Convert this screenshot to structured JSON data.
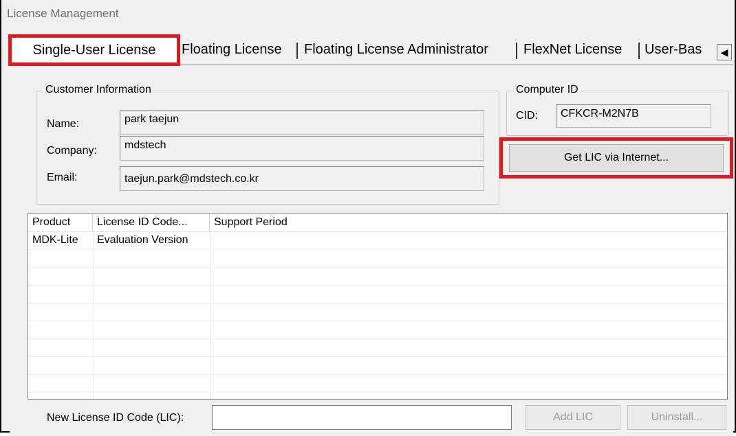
{
  "window": {
    "title": "License Management"
  },
  "tabs": [
    {
      "label": "Single-User License",
      "active": true
    },
    {
      "label": "Floating License"
    },
    {
      "label": "Floating License Administrator"
    },
    {
      "label": "FlexNet License"
    },
    {
      "label": "User-Bas"
    }
  ],
  "tab_scroll_icon": "left-arrow-icon",
  "customer": {
    "group_label": "Customer Information",
    "name_label": "Name:",
    "name_value": "park taejun",
    "company_label": "Company:",
    "company_value": "mdstech",
    "email_label": "Email:",
    "email_value": "taejun.park@mdstech.co.kr"
  },
  "computer": {
    "group_label": "Computer ID",
    "cid_label": "CID:",
    "cid_value": "CFKCR-M2N7B"
  },
  "get_lic_button": "Get LIC via Internet...",
  "list": {
    "columns": [
      "Product",
      "License ID Code...",
      "Support Period"
    ],
    "rows": [
      {
        "product": "MDK-Lite",
        "license": "Evaluation Version",
        "support": ""
      }
    ]
  },
  "footer": {
    "lic_label": "New License ID Code (LIC):",
    "lic_value": "",
    "add_button": "Add LIC",
    "uninstall_button": "Uninstall..."
  },
  "colors": {
    "highlight": "#e01820",
    "background": "#f0f0f0"
  }
}
